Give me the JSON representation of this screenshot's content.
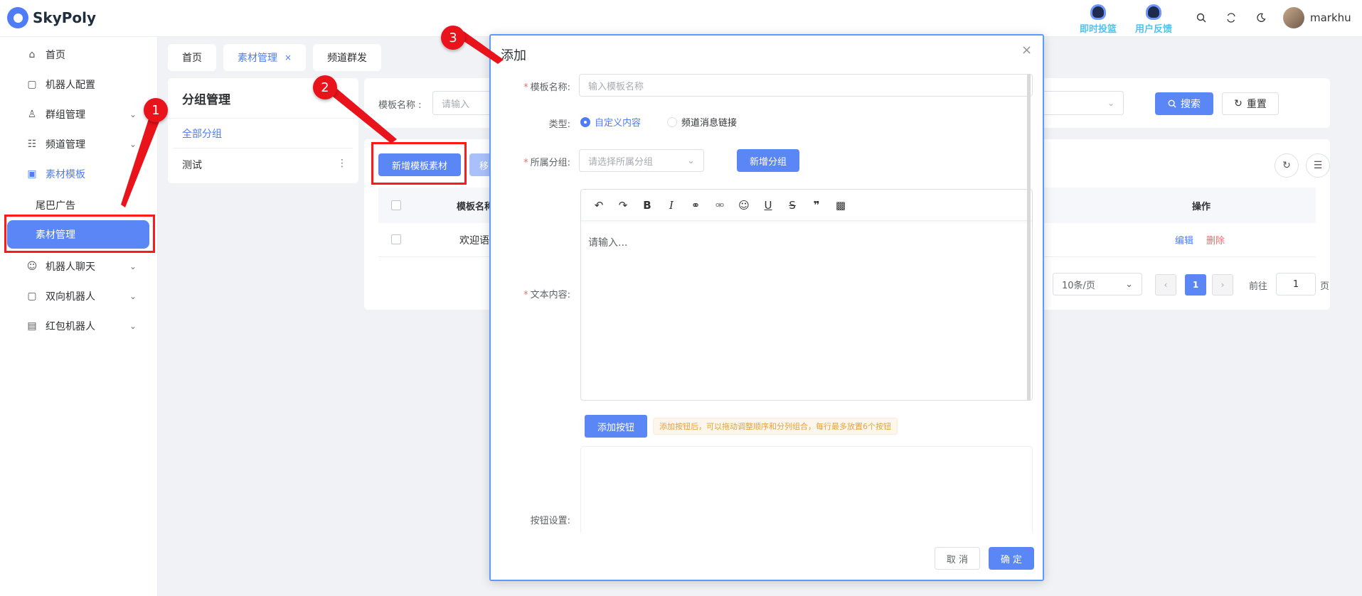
{
  "header": {
    "app_name": "SkyPoly",
    "links": [
      {
        "label": "即时投篮",
        "icon": "robot-icon"
      },
      {
        "label": "用户反馈",
        "icon": "robot-icon"
      }
    ],
    "icons": [
      "search-icon",
      "refresh-icon",
      "moon-icon"
    ],
    "user_name": "markhu"
  },
  "sidebar": {
    "items": [
      {
        "label": "首页",
        "icon": "home-icon"
      },
      {
        "label": "机器人配置",
        "icon": "robot-icon"
      },
      {
        "label": "群组管理",
        "icon": "users-icon"
      },
      {
        "label": "频道管理",
        "icon": "list-icon"
      },
      {
        "label": "素材模板",
        "icon": "image-icon"
      },
      {
        "label": "尾巴广告",
        "icon": ""
      },
      {
        "label": "素材管理",
        "icon": ""
      },
      {
        "label": "机器人聊天",
        "icon": "chat-robot-icon"
      },
      {
        "label": "双向机器人",
        "icon": "robot-icon"
      },
      {
        "label": "红包机器人",
        "icon": "redpacket-icon"
      }
    ]
  },
  "tabs": [
    {
      "label": "首页"
    },
    {
      "label": "素材管理",
      "close": "×"
    },
    {
      "label": "频道群发"
    }
  ],
  "group_panel": {
    "title": "分组管理",
    "all": "全部分组",
    "items": [
      {
        "label": "测试",
        "more": "⋮"
      }
    ]
  },
  "search": {
    "label": "模板名称 :",
    "placeholder": "请输入",
    "search_btn": "搜索",
    "reset_btn": "重置"
  },
  "table": {
    "add_btn": "新增模板素材",
    "move_btn": "移",
    "headers": {
      "name": "模板名称",
      "op": "操作"
    },
    "rows": [
      {
        "name": "欢迎语",
        "edit": "编辑",
        "delete": "删除"
      }
    ],
    "page_size": "10条/页",
    "current_page": "1",
    "goto_label": "前往",
    "goto_value": "1",
    "goto_suffix": "页"
  },
  "dialog": {
    "title": "添加",
    "close": "×",
    "fields": {
      "name_label": "模板名称:",
      "name_placeholder": "输入模板名称",
      "type_label": "类型:",
      "type_options": [
        "自定义内容",
        "频道消息链接"
      ],
      "group_label": "所属分组:",
      "group_placeholder": "请选择所属分组",
      "add_group_btn": "新增分组",
      "text_label": "文本内容:",
      "editor_placeholder": "请输入...",
      "add_button_btn": "添加按钮",
      "hint": "添加按钮后，可以拖动调整顺序和分列组合，每行最多放置6个按钮",
      "button_setting_label": "按钮设置:"
    },
    "toolbar": [
      "undo-icon",
      "redo-icon",
      "bold-icon",
      "italic-icon",
      "link-icon",
      "unlink-icon",
      "emoji-icon",
      "underline-icon",
      "strikethrough-icon",
      "quote-icon",
      "mosaic-icon"
    ],
    "cancel": "取 消",
    "ok": "确 定"
  },
  "annotations": {
    "badge1": "1",
    "badge2": "2",
    "badge3": "3",
    "color": "#e8131b"
  }
}
